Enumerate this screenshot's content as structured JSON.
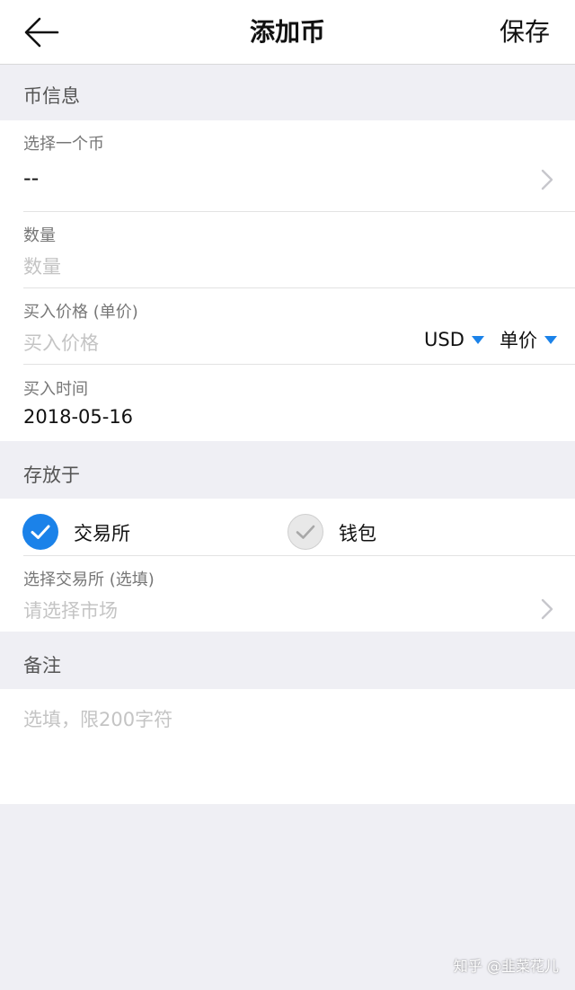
{
  "navbar": {
    "back_icon": "arrow-left-icon",
    "title": "添加币",
    "save_label": "保存"
  },
  "coin_info": {
    "section_title": "币信息",
    "select_coin": {
      "label": "选择一个币",
      "value": "--",
      "chevron_icon": "chevron-right-icon"
    },
    "quantity": {
      "label": "数量",
      "placeholder": "数量"
    },
    "buy_price": {
      "label": "买入价格 (单价)",
      "placeholder": "买入价格",
      "currency": "USD",
      "price_mode": "单价",
      "dropdown_icon": "triangle-down-icon"
    },
    "buy_time": {
      "label": "买入时间",
      "value": "2018-05-16"
    }
  },
  "storage": {
    "section_title": "存放于",
    "options": [
      {
        "label": "交易所",
        "selected": true
      },
      {
        "label": "钱包",
        "selected": false
      }
    ],
    "exchange": {
      "label": "选择交易所 (选填)",
      "placeholder": "请选择市场"
    }
  },
  "notes": {
    "section_title": "备注",
    "placeholder": "选填，限200字符"
  },
  "watermark": "知乎 @韭菜花儿",
  "colors": {
    "accent": "#1b82e9",
    "background": "#efeff4",
    "card": "#ffffff",
    "placeholder": "#c4c4c4",
    "label": "#777777"
  }
}
